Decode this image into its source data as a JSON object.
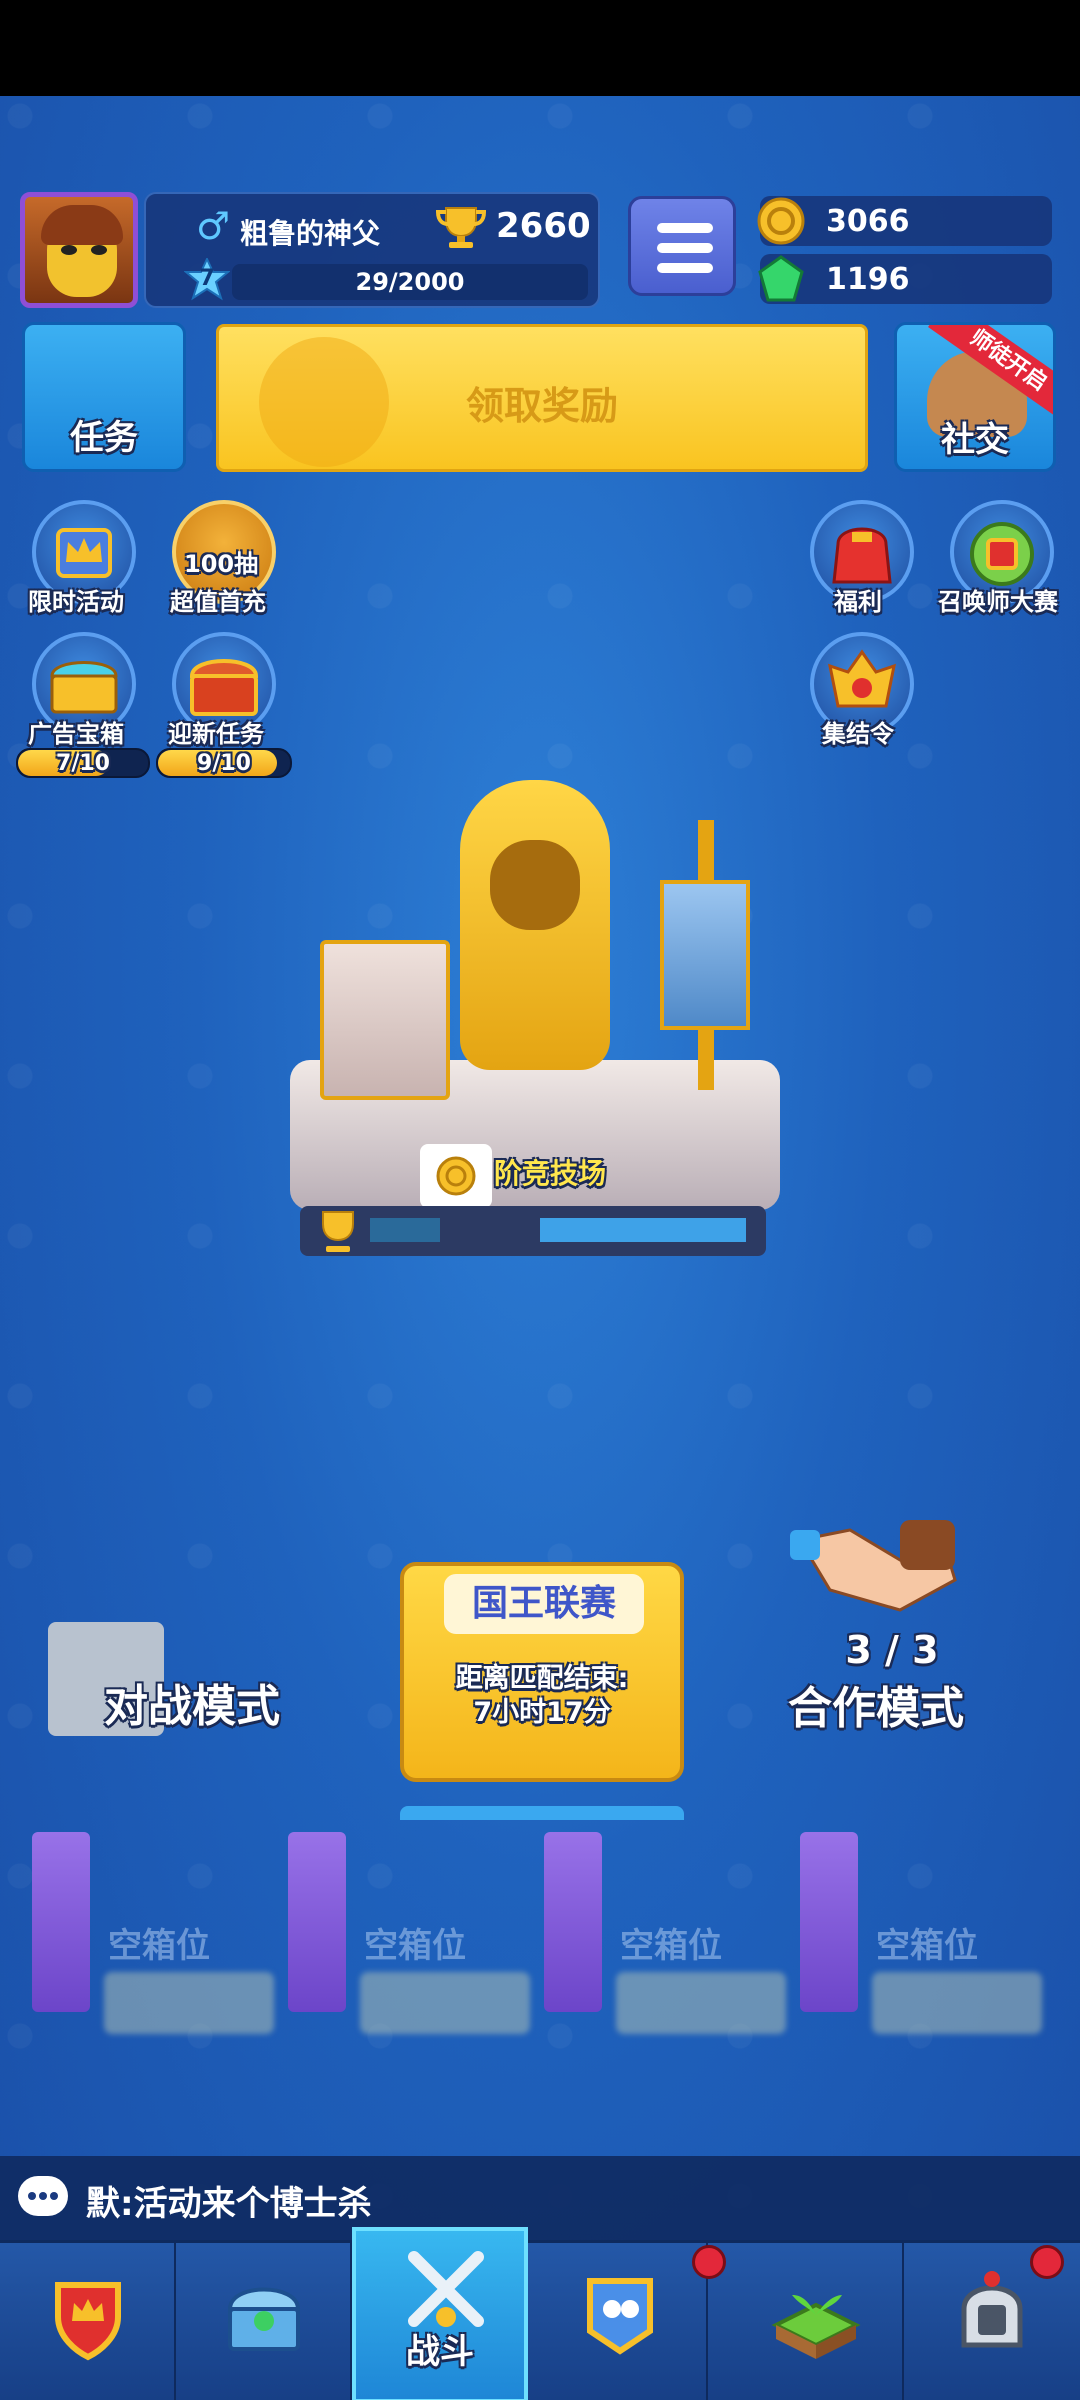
{
  "player": {
    "name": "粗鲁的神父",
    "gender_symbol": "♂",
    "level": "7",
    "trophies": "2660",
    "xp": "29/2000"
  },
  "currency": {
    "gold": "3066",
    "gems": "1196"
  },
  "buttons": {
    "task": "任务",
    "reward": "领取奖励",
    "social": "社交",
    "social_ribbon": "师徒开启"
  },
  "events": {
    "limited": "限时活动",
    "first_recharge": "超值首充",
    "first_recharge_badge": "100抽",
    "ad_chest": "广告宝箱",
    "ad_chest_progress": "7/10",
    "ad_chest_fraction": 0.7,
    "new_task": "迎新任务",
    "new_task_progress": "9/10",
    "new_task_fraction": 0.9,
    "welfare": "福利",
    "summoner": "召唤师大赛",
    "rally": "集结令"
  },
  "arena": {
    "name": "阶竞技场"
  },
  "modes": {
    "battle": "对战模式",
    "league_title": "国王联赛",
    "league_line1": "距离匹配结束:",
    "league_line2": "7小时17分",
    "coop_count": "3 / 3",
    "coop": "合作模式"
  },
  "chest_slots": [
    "空箱位",
    "空箱位",
    "空箱位",
    "空箱位"
  ],
  "chat": {
    "message": "默:活动来个博士杀"
  },
  "nav": {
    "active_label": "战斗"
  },
  "colors": {
    "accent_gold": "#f9c420",
    "panel_blue": "#1a86db",
    "notification_red": "#e3283a"
  }
}
